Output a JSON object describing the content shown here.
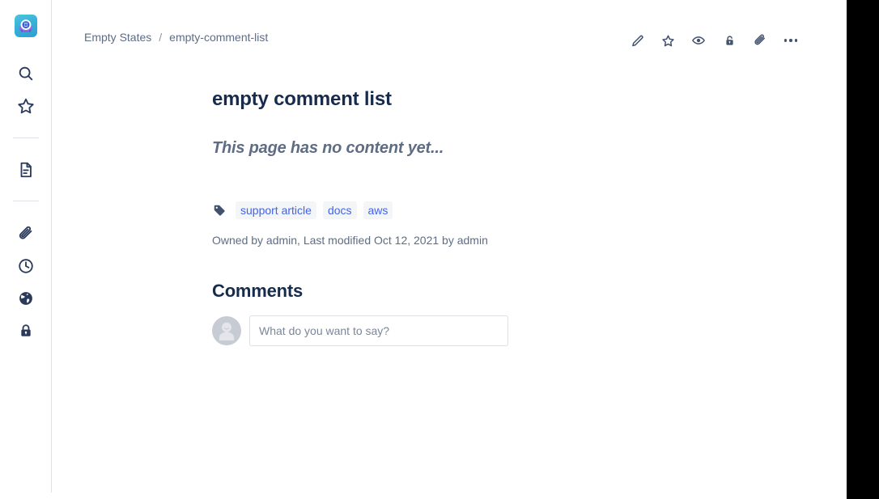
{
  "window": {
    "background_color": "#ffffff",
    "gutter_color": "#000000"
  },
  "global_nav": {
    "logo_name": "confluence-logo",
    "items": [
      {
        "name": "search",
        "icon": "search-icon",
        "label": "Search"
      },
      {
        "name": "starred",
        "icon": "star-icon",
        "label": "Starred"
      },
      {
        "name": "pages",
        "icon": "page-icon",
        "label": "Pages"
      },
      {
        "name": "attachments",
        "icon": "paperclip-icon",
        "label": "Attachments"
      },
      {
        "name": "page-history",
        "icon": "clock-icon",
        "label": "Page History"
      },
      {
        "name": "global-content",
        "icon": "globe-icon",
        "label": "Global"
      },
      {
        "name": "restrictions",
        "icon": "lock-icon",
        "label": "Restrictions"
      }
    ]
  },
  "header": {
    "breadcrumb": {
      "space": "Empty States",
      "separator": "/",
      "current": "empty-comment-list"
    },
    "actions": [
      {
        "name": "edit",
        "icon": "pencil-icon",
        "label": "Edit"
      },
      {
        "name": "favorite",
        "icon": "star-icon",
        "label": "Save for later"
      },
      {
        "name": "watch",
        "icon": "eye-icon",
        "label": "Watch"
      },
      {
        "name": "restrictions",
        "icon": "unlock-icon",
        "label": "Restrictions"
      },
      {
        "name": "attachments",
        "icon": "paperclip-icon",
        "label": "Attachments"
      },
      {
        "name": "more",
        "icon": "ellipsis-icon",
        "label": "More actions"
      }
    ]
  },
  "page": {
    "title": "empty comment list",
    "excerpt": "This page has no content yet...",
    "labels_icon": "tag-icon",
    "labels": [
      {
        "text": "support article"
      },
      {
        "text": "docs"
      },
      {
        "text": "aws"
      }
    ],
    "byline": "Owned by admin, Last modified Oct 12, 2021 by admin"
  },
  "comments": {
    "heading": "Comments",
    "avatar_name": "default-user-avatar",
    "input_placeholder": "What do you want to say?",
    "input_value": ""
  },
  "colors": {
    "text_primary": "#172b4d",
    "text_subtle": "#5e6c84",
    "link": "#4263eb",
    "chip_bg": "#f4f5f7",
    "border": "#dfe1e6"
  }
}
